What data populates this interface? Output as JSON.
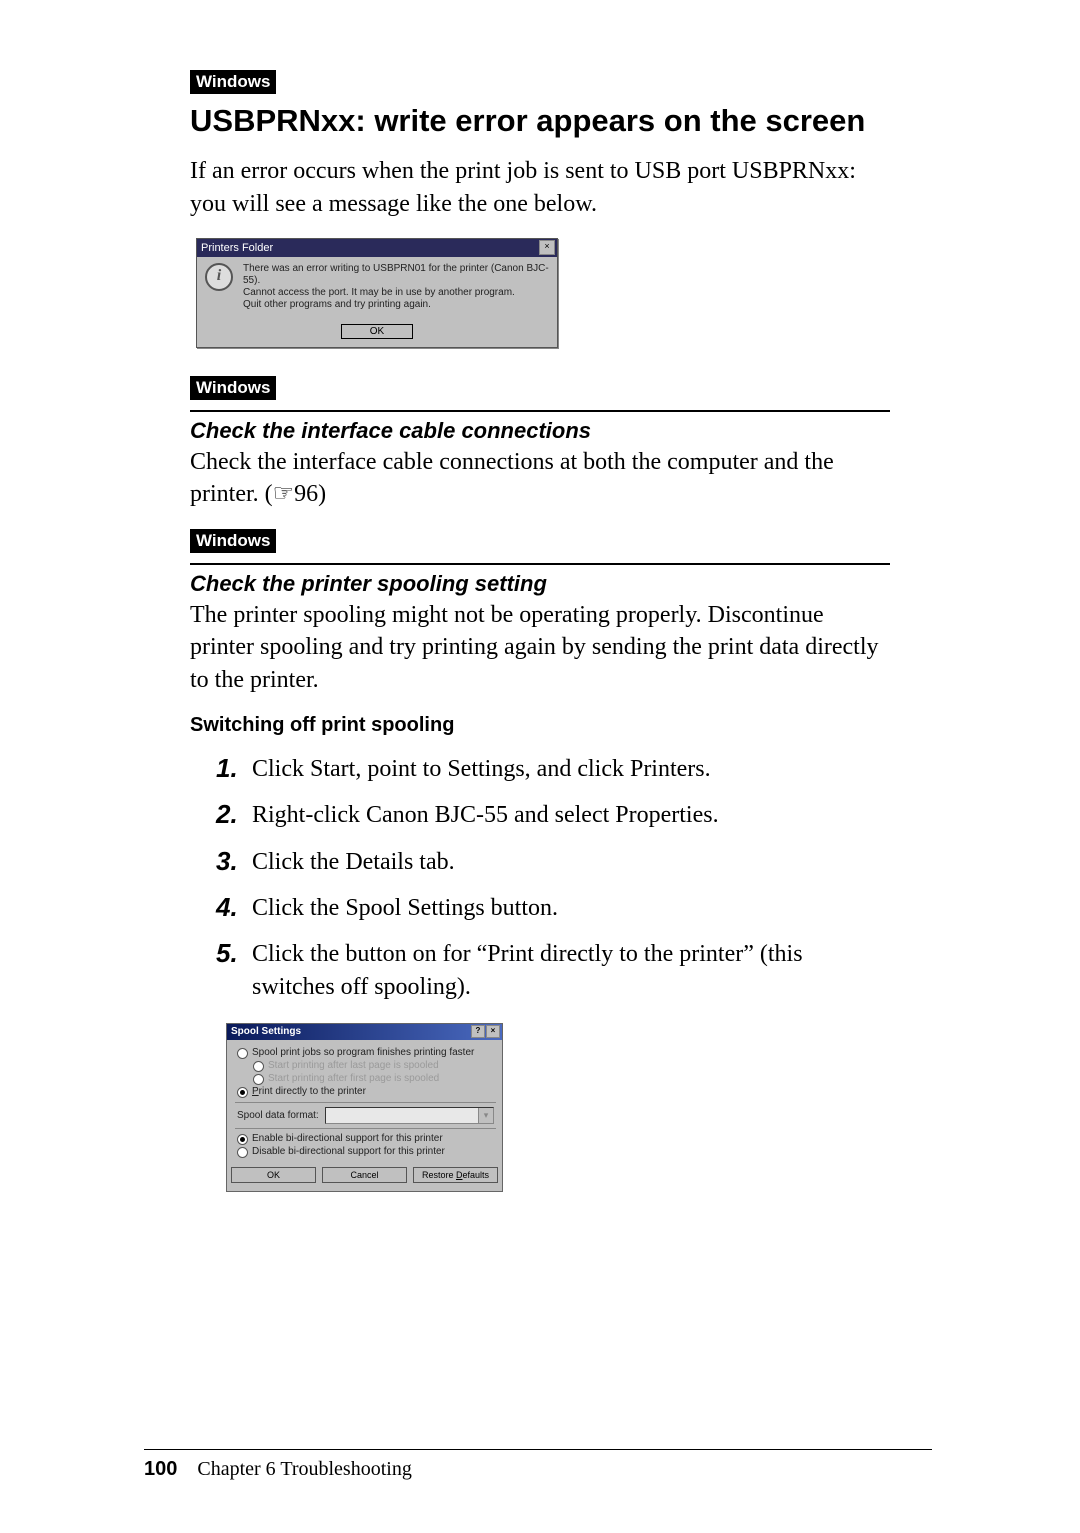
{
  "tags": {
    "windows": "Windows"
  },
  "heading": "USBPRNxx: write error appears on the screen",
  "intro": "If an error occurs when the print job is sent to USB port USBPRNxx: you will see a message like the one below.",
  "dialog1": {
    "title": "Printers Folder",
    "icon_letter": "i",
    "line1": "There was an error writing to USBPRN01 for the printer (Canon BJC-55).",
    "line2": "Cannot access the port. It may be in use by another program.",
    "line3": "Quit other programs and try printing again.",
    "ok": "OK",
    "closebox": "×"
  },
  "section1": {
    "title": "Check the interface cable connections",
    "body_a": "Check the interface cable connections at both the computer and the printer. (",
    "body_ref": "☞96",
    "body_b": ")"
  },
  "section2": {
    "title": "Check the printer spooling setting",
    "body": "The printer spooling might not be operating properly.  Discontinue printer spooling and try printing again by sending the print data directly to the printer.",
    "procedure_title": "Switching off print spooling",
    "steps": [
      "Click Start, point to Settings, and click Printers.",
      "Right-click Canon BJC-55 and select Properties.",
      "Click the Details tab.",
      "Click the Spool Settings button.",
      "Click the button on for “Print directly to the printer” (this switches off spooling)."
    ]
  },
  "dialog2": {
    "title": "Spool Settings",
    "opt1": "Spool print jobs so program finishes printing faster",
    "opt1a": "Start printing after last page is spooled",
    "opt1b": "Start printing after first page is spooled",
    "opt2_pre": "P",
    "opt2_rest": "rint directly to the printer",
    "format_label": "Spool data format:",
    "format_value": "",
    "bidi1": "Enable bi-directional support for this printer",
    "bidi2": "Disable bi-directional support for this printer",
    "ok": "OK",
    "cancel": "Cancel",
    "restore_pre": "Restore ",
    "restore_u": "D",
    "restore_post": "efaults"
  },
  "footer": {
    "page": "100",
    "chapter": "Chapter 6   Troubleshooting"
  }
}
